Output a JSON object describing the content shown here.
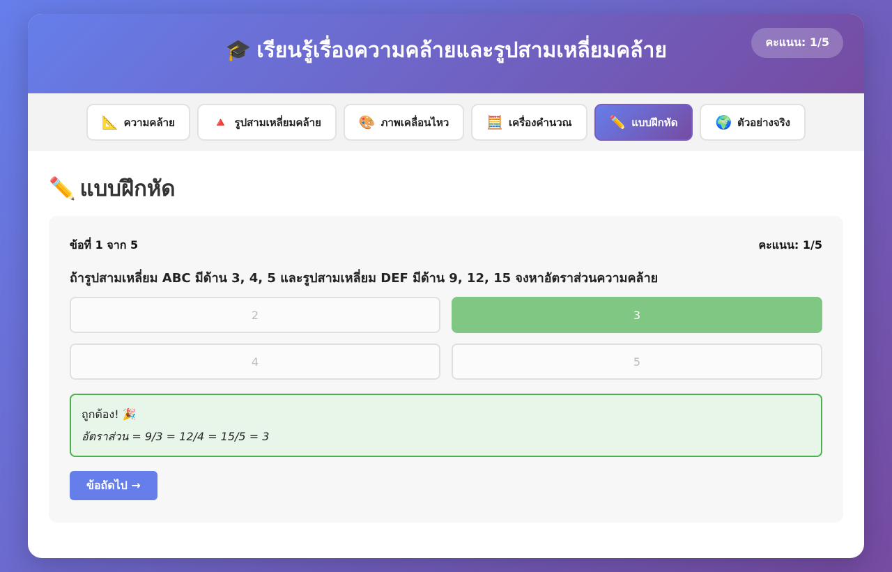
{
  "header": {
    "icon": "🎓",
    "title": "เรียนรู้เรื่องความคล้ายและรูปสามเหลี่ยมคล้าย",
    "score": "คะแนน: 1/5"
  },
  "tabs": [
    {
      "icon": "📐",
      "icon_name": "triangle-ruler-icon",
      "label": "ความคล้าย"
    },
    {
      "icon": "🔺",
      "icon_name": "red-triangle-icon",
      "label": "รูปสามเหลี่ยมคล้าย"
    },
    {
      "icon": "🎨",
      "icon_name": "palette-icon",
      "label": "ภาพเคลื่อนไหว"
    },
    {
      "icon": "🧮",
      "icon_name": "abacus-icon",
      "label": "เครื่องคำนวณ"
    },
    {
      "icon": "✏️",
      "icon_name": "pencil-icon",
      "label": "แบบฝึกหัด",
      "active": true
    },
    {
      "icon": "🌍",
      "icon_name": "globe-icon",
      "label": "ตัวอย่างจริง"
    }
  ],
  "section": {
    "icon": "✏️",
    "title": "แบบฝึกหัด"
  },
  "quiz": {
    "progress": "ข้อที่ 1 จาก 5",
    "score": "คะแนน: 1/5",
    "question": "ถ้ารูปสามเหลี่ยม ABC มีด้าน 3, 4, 5 และรูปสามเหลี่ยม DEF มีด้าน 9, 12, 15 จงหาอัตราส่วนความคล้าย",
    "options": [
      "2",
      "3",
      "4",
      "5"
    ],
    "correct_index": 1,
    "feedback_title": "ถูกต้อง! 🎉",
    "feedback_detail": "อัตราส่วน = 9/3 = 12/4 = 15/5 = 3",
    "next_label": "ข้อถัดไป →"
  },
  "colors": {
    "accent": "#667eea",
    "accent_end": "#764ba2",
    "correct": "#81c784",
    "feedback_border": "#4caf50",
    "feedback_bg": "#e8f5e9"
  }
}
